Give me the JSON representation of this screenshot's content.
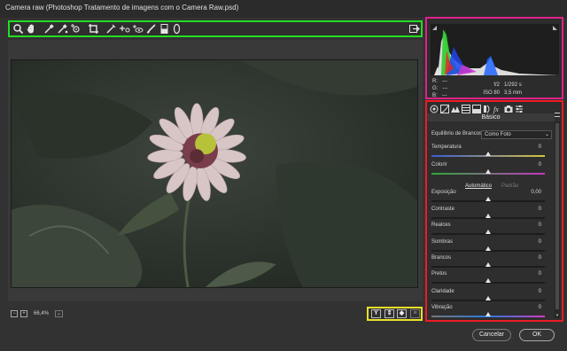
{
  "window": {
    "title": "Camera raw (Photoshop Tratamento de imagens com o Camera Raw.psd)"
  },
  "toolbar": {
    "tools": [
      "zoom-icon",
      "hand-icon",
      "white-balance-icon",
      "color-sampler-icon",
      "targeted-adjustment-icon",
      "crop-icon",
      "straighten-icon",
      "spot-removal-icon",
      "red-eye-icon",
      "adjustment-brush-icon",
      "graduated-filter-icon",
      "radial-filter-icon"
    ],
    "open_preferences_icon": "export-icon"
  },
  "zoom": {
    "value": "66,4%"
  },
  "histogram": {
    "readout": {
      "r_label": "R:",
      "r_value": "---",
      "g_label": "G:",
      "g_value": "---",
      "b_label": "B:",
      "b_value": "---"
    },
    "aperture": "f/2",
    "shutter": "1/292 s",
    "iso": "ISO 80",
    "focal": "3,5 mm"
  },
  "panel": {
    "section_title": "Básico",
    "white_balance": {
      "label": "Equilíbrio de Brancos:",
      "value": "Como Foto"
    },
    "auto_label": "Automático",
    "default_label": "Padrão",
    "adjustments": [
      {
        "label": "Temperatura",
        "value": "0",
        "position": 0.5
      },
      {
        "label": "Colorir",
        "value": "0",
        "position": 0.5
      },
      {
        "label": "Exposição",
        "value": "0,00",
        "position": 0.5
      },
      {
        "label": "Contraste",
        "value": "0",
        "position": 0.5
      },
      {
        "label": "Realces",
        "value": "0",
        "position": 0.5
      },
      {
        "label": "Sombras",
        "value": "0",
        "position": 0.5
      },
      {
        "label": "Brancos",
        "value": "0",
        "position": 0.5
      },
      {
        "label": "Pretos",
        "value": "0",
        "position": 0.5
      },
      {
        "label": "Claridade",
        "value": "0",
        "position": 0.5
      },
      {
        "label": "Vibração",
        "value": "0",
        "position": 0.5
      }
    ]
  },
  "buttons": {
    "cancel": "Cancelar",
    "ok": "OK"
  },
  "colors": {
    "toolbar_highlight": "#22dd22",
    "histogram_highlight": "#e0218a",
    "panel_highlight": "#ee1b24",
    "view_highlight": "#e8e02a"
  }
}
